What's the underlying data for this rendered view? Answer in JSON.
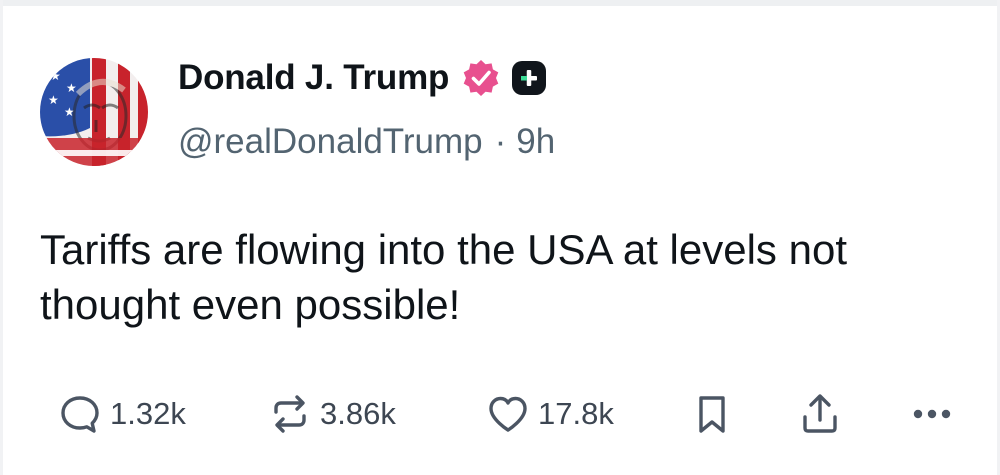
{
  "post": {
    "author": {
      "display_name": "Donald J. Trump",
      "handle": "@realDonaldTrump",
      "separator": "·",
      "time": "9h",
      "avatar_icon": "avatar-flag-portrait",
      "verified_icon": "verified-badge-icon",
      "verified_color": "#e8508f",
      "plus_icon": "plus-badge-icon"
    },
    "text": "Tariffs are flowing into the USA at levels not thought even possible!",
    "actions": {
      "reply": {
        "icon": "comment-icon",
        "count": "1.32k"
      },
      "repost": {
        "icon": "repost-icon",
        "count": "3.86k"
      },
      "like": {
        "icon": "heart-icon",
        "count": "17.8k"
      },
      "bookmark": {
        "icon": "bookmark-icon"
      },
      "share": {
        "icon": "share-icon"
      },
      "more": {
        "icon": "more-icon"
      }
    }
  }
}
